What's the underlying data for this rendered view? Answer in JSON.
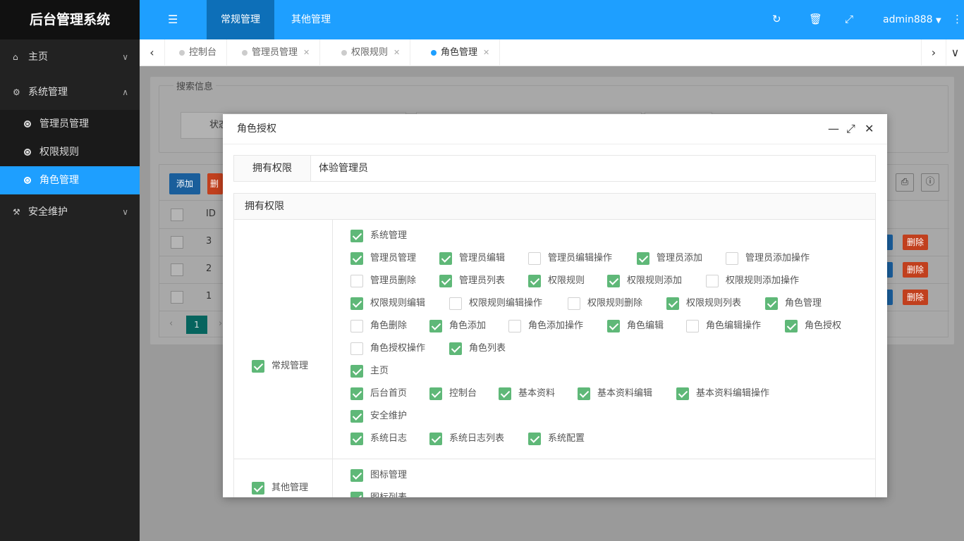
{
  "app": {
    "title": "后台管理系统"
  },
  "sidebar": {
    "items": [
      {
        "label": "主页",
        "icon": "home-icon"
      },
      {
        "label": "系统管理",
        "icon": "gears-icon"
      },
      {
        "label": "安全维护",
        "icon": "gavel-icon"
      }
    ],
    "sub": [
      "管理员管理",
      "权限规则",
      "角色管理"
    ]
  },
  "header": {
    "tabs": [
      "常规管理",
      "其他管理"
    ],
    "user": "admin888",
    "icons": [
      "refresh-icon",
      "trash-icon",
      "fullscreen-icon",
      "more-icon"
    ]
  },
  "pagetabs": [
    {
      "label": "控制台"
    },
    {
      "label": "管理员管理"
    },
    {
      "label": "权限规则"
    },
    {
      "label": "角色管理"
    }
  ],
  "bg": {
    "search_legend": "搜索信息",
    "status_label": "状态",
    "add_label": "添加",
    "del_label": "删",
    "id_header": "ID",
    "ids": [
      "3",
      "2",
      "1"
    ],
    "delete_label": "删除",
    "page": "1"
  },
  "modal": {
    "title": "角色授权",
    "own_label": "拥有权限",
    "own_value": "体验管理员",
    "perm_header": "拥有权限",
    "groups": [
      {
        "label": "常规管理",
        "checked": true,
        "rows": [
          [
            {
              "t": "系统管理",
              "c": true
            }
          ],
          [
            {
              "t": "管理员管理",
              "c": true
            },
            {
              "t": "管理员编辑",
              "c": true
            },
            {
              "t": "管理员编辑操作",
              "c": false
            },
            {
              "t": "管理员添加",
              "c": true
            },
            {
              "t": "管理员添加操作",
              "c": false
            }
          ],
          [
            {
              "t": "管理员删除",
              "c": false
            },
            {
              "t": "管理员列表",
              "c": true
            },
            {
              "t": "权限规则",
              "c": true
            },
            {
              "t": "权限规则添加",
              "c": true
            },
            {
              "t": "权限规则添加操作",
              "c": false
            }
          ],
          [
            {
              "t": "权限规则编辑",
              "c": true
            },
            {
              "t": "权限规则编辑操作",
              "c": false
            },
            {
              "t": "权限规则删除",
              "c": false
            },
            {
              "t": "权限规则列表",
              "c": true
            },
            {
              "t": "角色管理",
              "c": true
            }
          ],
          [
            {
              "t": "角色删除",
              "c": false
            },
            {
              "t": "角色添加",
              "c": true
            },
            {
              "t": "角色添加操作",
              "c": false
            },
            {
              "t": "角色编辑",
              "c": true
            },
            {
              "t": "角色编辑操作",
              "c": false
            },
            {
              "t": "角色授权",
              "c": true
            }
          ],
          [
            {
              "t": "角色授权操作",
              "c": false
            },
            {
              "t": "角色列表",
              "c": true
            }
          ],
          [
            {
              "t": "主页",
              "c": true
            }
          ],
          [
            {
              "t": "后台首页",
              "c": true
            },
            {
              "t": "控制台",
              "c": true
            },
            {
              "t": "基本资料",
              "c": true
            },
            {
              "t": "基本资料编辑",
              "c": true
            },
            {
              "t": "基本资料编辑操作",
              "c": true
            }
          ],
          [
            {
              "t": "安全维护",
              "c": true
            }
          ],
          [
            {
              "t": "系统日志",
              "c": true
            },
            {
              "t": "系统日志列表",
              "c": true
            },
            {
              "t": "系统配置",
              "c": true
            }
          ]
        ]
      },
      {
        "label": "其他管理",
        "checked": true,
        "rows": [
          [
            {
              "t": "图标管理",
              "c": true
            }
          ],
          [
            {
              "t": "图标列表",
              "c": true
            }
          ]
        ]
      }
    ]
  }
}
